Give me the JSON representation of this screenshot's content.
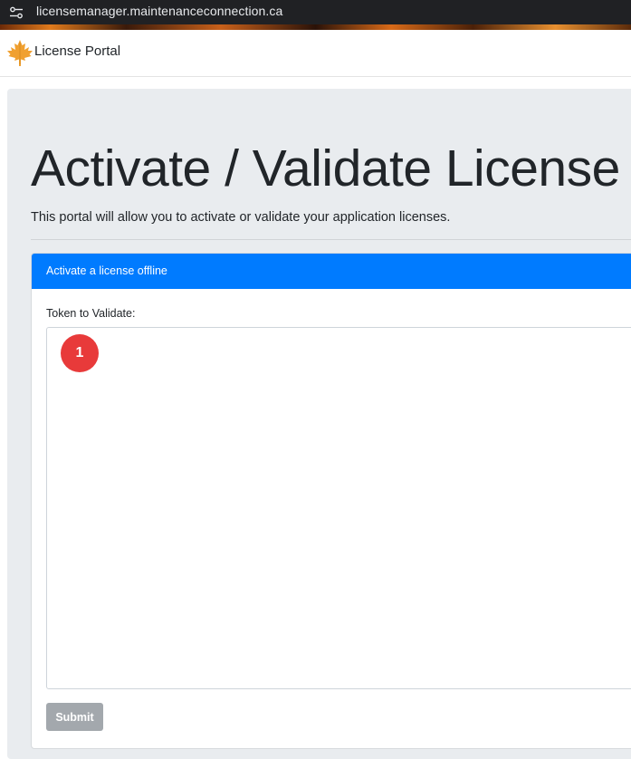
{
  "browser": {
    "url": "licensemanager.maintenanceconnection.ca",
    "site_info_icon": "tune-icon"
  },
  "navbar": {
    "brand": "License Portal",
    "logo_icon": "maple-leaf-icon",
    "logo_color": "#f0a030"
  },
  "page": {
    "title": "Activate / Validate License",
    "lead": "This portal will allow you to activate or validate your application licenses."
  },
  "card": {
    "header": "Activate a license offline",
    "header_color": "#007bff",
    "token_label": "Token to Validate:",
    "token_value": "",
    "submit_label": "Submit"
  },
  "annotation": {
    "marker_number": "1",
    "marker_color": "#e83a3a"
  }
}
